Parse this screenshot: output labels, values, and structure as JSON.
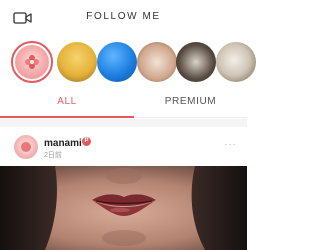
{
  "header": {
    "title": "FOLLOW ME",
    "camera_icon": "video-camera-icon"
  },
  "stories": [
    {
      "name": "story-avatar-self",
      "active": true
    },
    {
      "name": "story-avatar-2"
    },
    {
      "name": "story-avatar-3"
    },
    {
      "name": "story-avatar-4"
    },
    {
      "name": "story-avatar-5"
    },
    {
      "name": "story-avatar-6"
    }
  ],
  "tabs": {
    "all": "ALL",
    "premium": "PREMIUM",
    "active": "ALL"
  },
  "colors": {
    "accent": "#e25a5e"
  },
  "post": {
    "username": "manami",
    "badge": "P",
    "time": "2日前",
    "more": "···"
  }
}
